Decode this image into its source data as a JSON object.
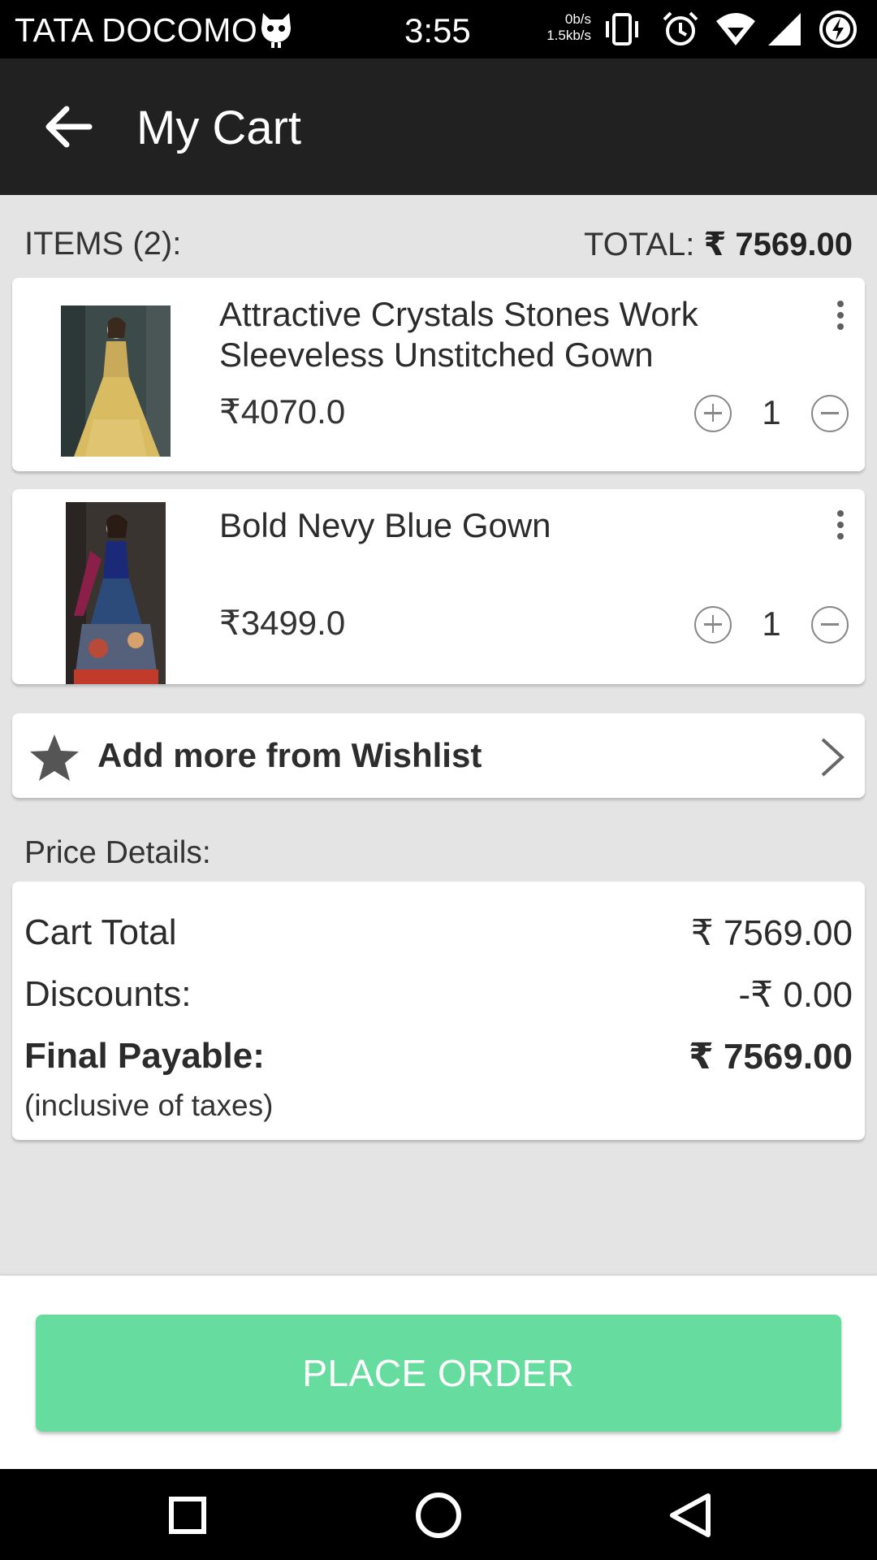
{
  "status_bar": {
    "carrier": "TATA DOCOMO",
    "time": "3:55",
    "net_down": "0b/s",
    "net_up": "1.5kb/s",
    "icons": [
      "cat-icon",
      "vibrate-icon",
      "alarm-icon",
      "wifi-icon",
      "signal-icon",
      "battery-charging-icon"
    ]
  },
  "app_bar": {
    "back_icon": "arrow-left-icon",
    "title": "My Cart"
  },
  "summary": {
    "items_label": "ITEMS (2):",
    "total_prefix": "TOTAL: ",
    "total_value": "₹ 7569.00"
  },
  "cart_items": [
    {
      "name": "Attractive Crystals Stones Work Sleeveless Unstitched Gown",
      "price": "₹4070.0",
      "quantity": "1"
    },
    {
      "name": "Bold Nevy Blue  Gown",
      "price": "₹3499.0",
      "quantity": "1"
    }
  ],
  "wishlist": {
    "icon": "star-icon",
    "label": "Add more from Wishlist",
    "chevron_icon": "chevron-right-icon"
  },
  "price_details": {
    "heading": "Price Details:",
    "cart_total_label": "Cart Total",
    "cart_total_value": "₹ 7569.00",
    "discounts_label": "Discounts:",
    "discounts_value": "-₹ 0.00",
    "final_label": "Final Payable:",
    "final_value": "₹ 7569.00",
    "note": "(inclusive of taxes)"
  },
  "footer": {
    "place_order_label": "PLACE ORDER"
  },
  "colors": {
    "app_bar": "#212121",
    "accent_button": "#66dd9f",
    "background": "#e4e4e4"
  },
  "nav_bar": {
    "icons": [
      "recents-square-icon",
      "home-circle-icon",
      "back-triangle-icon"
    ]
  }
}
